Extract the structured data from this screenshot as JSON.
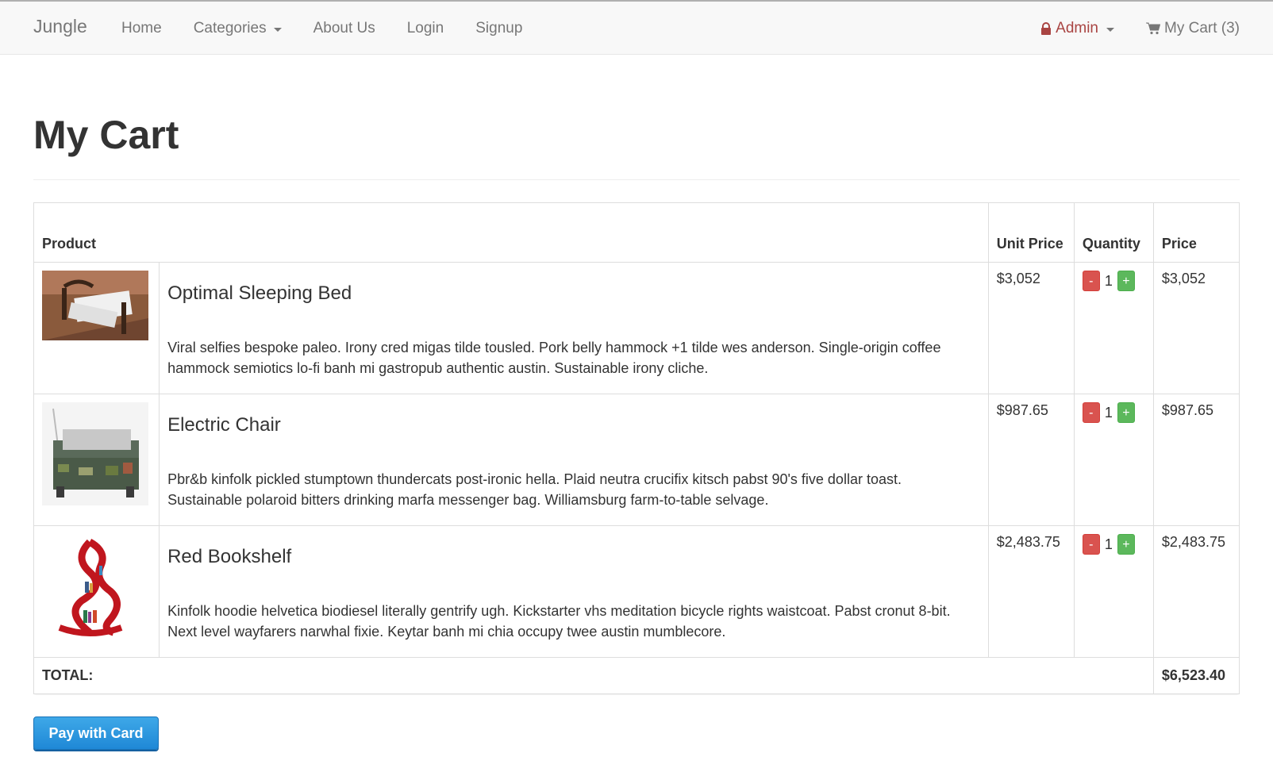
{
  "navbar": {
    "brand": "Jungle",
    "links": [
      "Home",
      "Categories",
      "About Us",
      "Login",
      "Signup"
    ],
    "admin_label": "Admin",
    "cart_label": "My Cart (3)",
    "admin_color": "#a94442"
  },
  "page": {
    "title": "My Cart"
  },
  "table": {
    "headers": {
      "product": "Product",
      "unit_price": "Unit Price",
      "quantity": "Quantity",
      "price": "Price"
    },
    "rows": [
      {
        "image": "bed-image",
        "name": "Optimal Sleeping Bed",
        "description": "Viral selfies bespoke paleo. Irony cred migas tilde tousled. Pork belly hammock +1 tilde wes anderson. Single-origin coffee hammock semiotics lo-fi banh mi gastropub authentic austin. Sustainable irony cliche.",
        "unit_price": "$3,052",
        "quantity": "1",
        "price": "$3,052"
      },
      {
        "image": "chair-image",
        "name": "Electric Chair",
        "description": "Pbr&b kinfolk pickled stumptown thundercats post-ironic hella. Plaid neutra crucifix kitsch pabst 90's five dollar toast. Sustainable polaroid bitters drinking marfa messenger bag. Williamsburg farm-to-table selvage.",
        "unit_price": "$987.65",
        "quantity": "1",
        "price": "$987.65"
      },
      {
        "image": "bookshelf-image",
        "name": "Red Bookshelf",
        "description": "Kinfolk hoodie helvetica biodiesel literally gentrify ugh. Kickstarter vhs meditation bicycle rights waistcoat. Pabst cronut 8-bit. Next level wayfarers narwhal fixie. Keytar banh mi chia occupy twee austin mumblecore.",
        "unit_price": "$2,483.75",
        "quantity": "1",
        "price": "$2,483.75"
      }
    ],
    "minus_label": "-",
    "plus_label": "+",
    "total_label": "TOTAL:",
    "total_value": "$6,523.40"
  },
  "actions": {
    "pay_label": "Pay with Card",
    "pay_color": "#2b95df"
  }
}
